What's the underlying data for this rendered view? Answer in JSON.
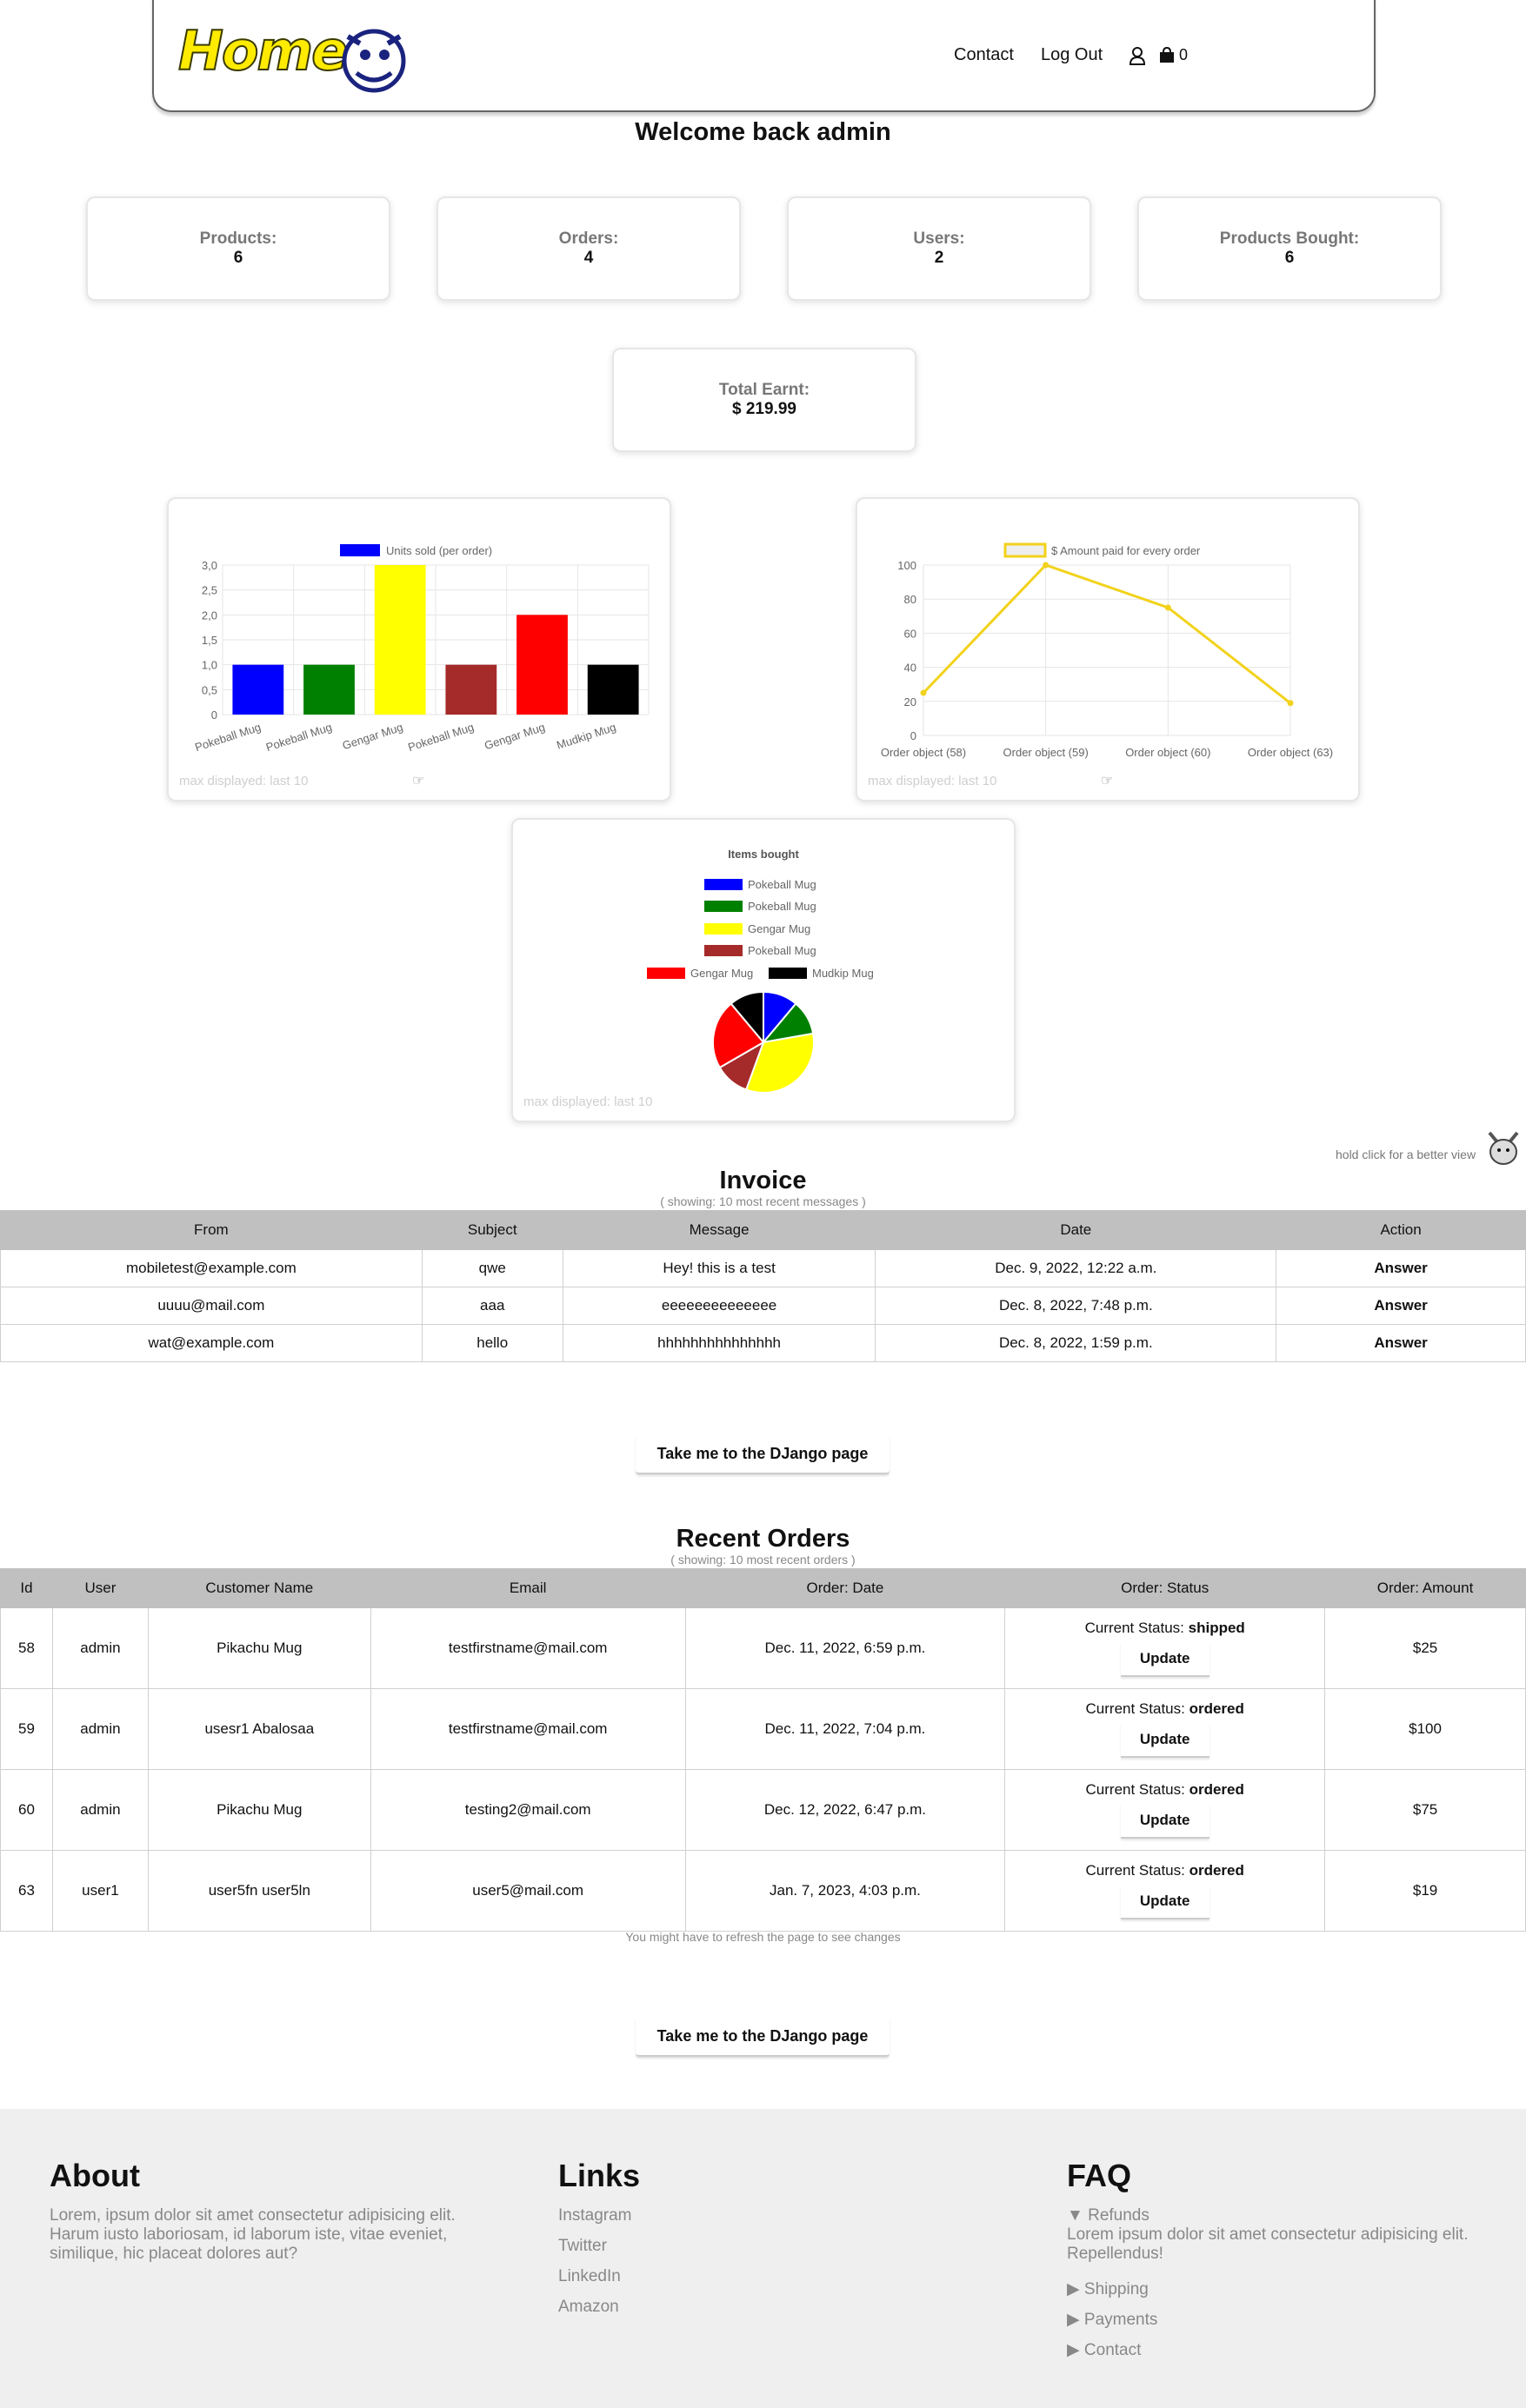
{
  "header": {
    "logo_text": "Home",
    "nav": {
      "contact": "Contact",
      "logout": "Log Out",
      "cart_count": "0"
    }
  },
  "welcome": "Welcome back admin",
  "stats": [
    {
      "label": "Products:",
      "value": "6"
    },
    {
      "label": "Orders:",
      "value": "4"
    },
    {
      "label": "Users:",
      "value": "2"
    },
    {
      "label": "Products Bought:",
      "value": "6"
    }
  ],
  "total": {
    "label": "Total Earnt:",
    "value": "$ 219.99"
  },
  "max_note": "max displayed: last 10",
  "hold_note": "hold click for a better view",
  "chart_data": [
    {
      "type": "bar",
      "legend": "Units sold (per order)",
      "categories": [
        "Pokeball Mug",
        "Pokeball Mug",
        "Gengar Mug",
        "Pokeball Mug",
        "Gengar Mug",
        "Mudkip Mug"
      ],
      "values": [
        1,
        1,
        3,
        1,
        2,
        1
      ],
      "colors": [
        "#0000ff",
        "#008000",
        "#ffff00",
        "#a52a2a",
        "#ff0000",
        "#000000"
      ],
      "ylim": [
        0,
        3
      ],
      "yticks": [
        "0",
        "0,5",
        "1,0",
        "1,5",
        "2,0",
        "2,5",
        "3,0"
      ],
      "grid": true
    },
    {
      "type": "line",
      "legend": "$ Amount paid for every order",
      "categories": [
        "Order object (58)",
        "Order object (59)",
        "Order object (60)",
        "Order object (63)"
      ],
      "values": [
        25,
        100,
        75,
        19
      ],
      "color": "#f2d21b",
      "ylim": [
        0,
        100
      ],
      "yticks": [
        "0",
        "20",
        "40",
        "60",
        "80",
        "100"
      ],
      "grid": true
    },
    {
      "type": "pie",
      "title": "Items bought",
      "labels": [
        "Pokeball Mug",
        "Pokeball Mug",
        "Gengar Mug",
        "Pokeball Mug",
        "Gengar Mug",
        "Mudkip Mug"
      ],
      "values": [
        1,
        1,
        3,
        1,
        2,
        1
      ],
      "colors": [
        "#0000ff",
        "#008000",
        "#ffff00",
        "#a52a2a",
        "#ff0000",
        "#000000"
      ]
    }
  ],
  "invoice": {
    "title": "Invoice",
    "subtitle": "( showing: 10 most recent messages )",
    "headers": [
      "From",
      "Subject",
      "Message",
      "Date",
      "Action"
    ],
    "rows": [
      {
        "from": "mobiletest@example.com",
        "subject": "qwe",
        "message": "Hey! this is a test",
        "date": "Dec. 9, 2022, 12:22 a.m.",
        "action": "Answer"
      },
      {
        "from": "uuuu@mail.com",
        "subject": "aaa",
        "message": "eeeeeeeeeeeeee",
        "date": "Dec. 8, 2022, 7:48 p.m.",
        "action": "Answer"
      },
      {
        "from": "wat@example.com",
        "subject": "hello",
        "message": "hhhhhhhhhhhhhhh",
        "date": "Dec. 8, 2022, 1:59 p.m.",
        "action": "Answer"
      }
    ]
  },
  "django_button": "Take me to the DJango page",
  "orders": {
    "title": "Recent Orders",
    "subtitle": "( showing: 10 most recent orders )",
    "headers": [
      "Id",
      "User",
      "Customer Name",
      "Email",
      "Order: Date",
      "Order: Status",
      "Order: Amount"
    ],
    "status_prefix": "Current Status:",
    "update_label": "Update",
    "rows": [
      {
        "id": "58",
        "user": "admin",
        "customer": "Pikachu Mug",
        "email": "testfirstname@mail.com",
        "date": "Dec. 11, 2022, 6:59 p.m.",
        "status": "shipped",
        "amount": "$25"
      },
      {
        "id": "59",
        "user": "admin",
        "customer": "usesr1 Abalosaa",
        "email": "testfirstname@mail.com",
        "date": "Dec. 11, 2022, 7:04 p.m.",
        "status": "ordered",
        "amount": "$100"
      },
      {
        "id": "60",
        "user": "admin",
        "customer": "Pikachu Mug",
        "email": "testing2@mail.com",
        "date": "Dec. 12, 2022, 6:47 p.m.",
        "status": "ordered",
        "amount": "$75"
      },
      {
        "id": "63",
        "user": "user1",
        "customer": "user5fn user5ln",
        "email": "user5@mail.com",
        "date": "Jan. 7, 2023, 4:03 p.m.",
        "status": "ordered",
        "amount": "$19"
      }
    ],
    "refresh_note": "You might have to refresh the page to see changes"
  },
  "footer": {
    "about": {
      "title": "About",
      "text": "Lorem, ipsum dolor sit amet consectetur adipisicing elit. Harum iusto laboriosam, id laborum iste, vitae eveniet, similique, hic placeat dolores aut?"
    },
    "links": {
      "title": "Links",
      "items": [
        "Instagram",
        "Twitter",
        "LinkedIn",
        "Amazon"
      ]
    },
    "faq": {
      "title": "FAQ",
      "open_item": "Refunds",
      "open_text": "Lorem ipsum dolor sit amet consectetur adipisicing elit. Repellendus!",
      "items": [
        "Shipping",
        "Payments",
        "Contact"
      ]
    }
  }
}
